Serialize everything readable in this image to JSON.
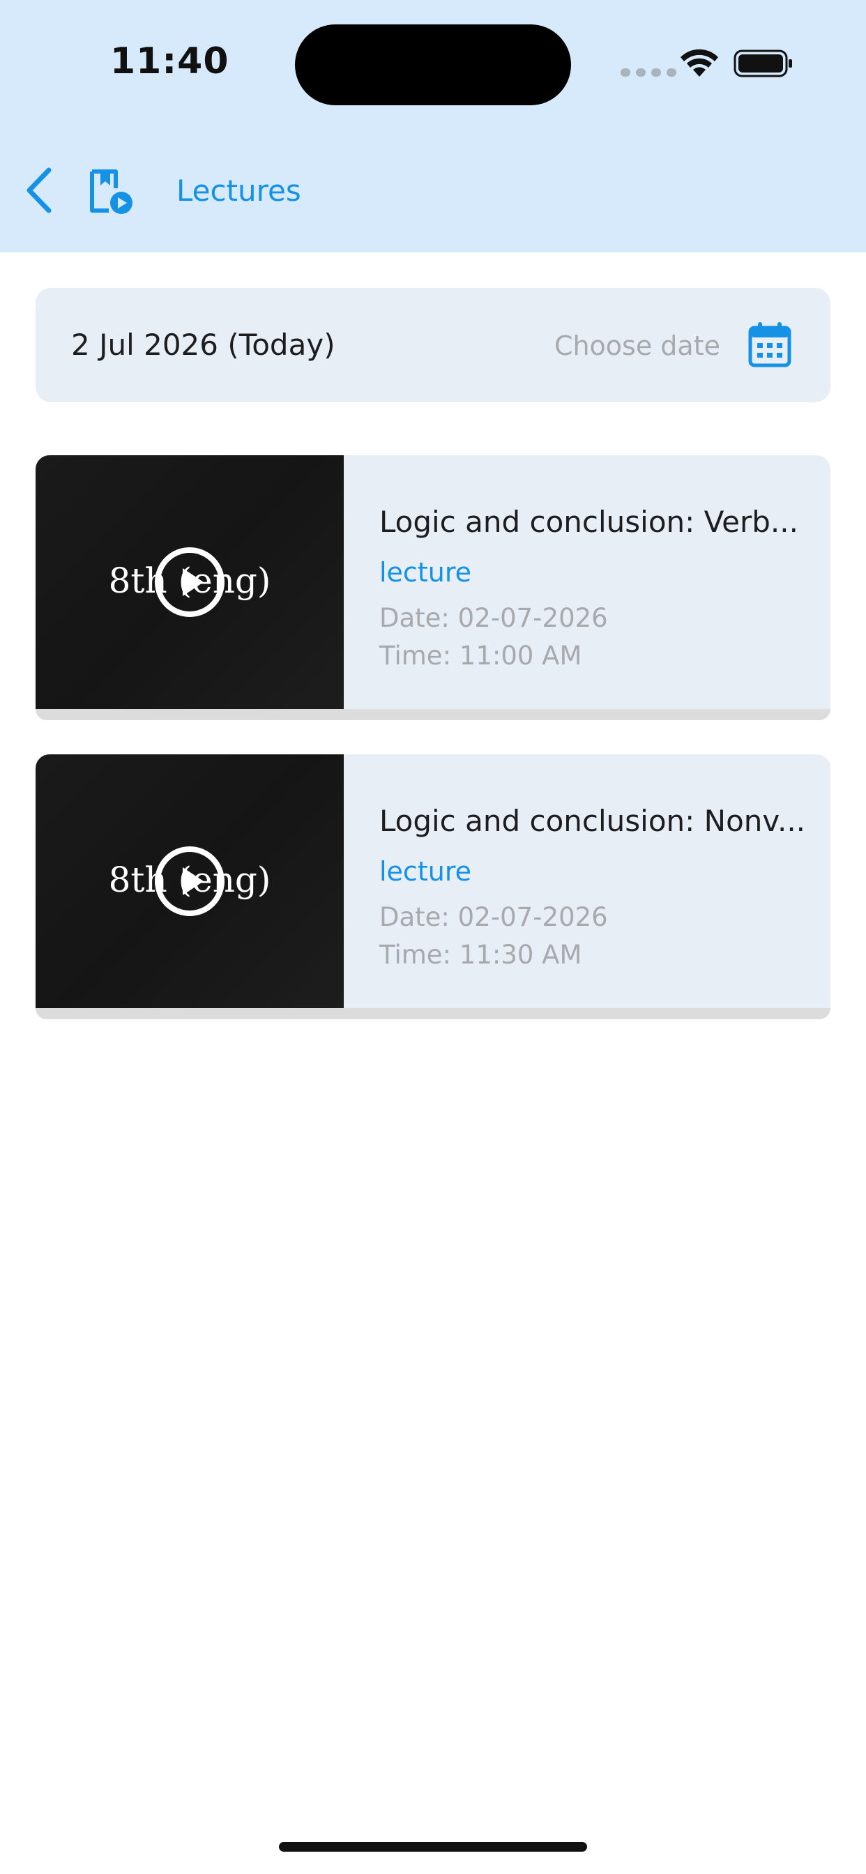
{
  "status_bar": {
    "time": "11:40"
  },
  "header": {
    "title": "Lectures",
    "background": "#d6eafb",
    "accent": "#1592e6",
    "back_icon": "chevron-left-icon",
    "page_icon": "lecture-video-icon"
  },
  "date_picker": {
    "selected_date": "2 Jul 2026 (Today)",
    "choose_label": "Choose date",
    "icon": "calendar-icon"
  },
  "lectures": [
    {
      "thumbnail_text": "8th (eng)",
      "title": "Logic and conclusion: Verb...",
      "type": "lecture",
      "date": "Date: 02-07-2026",
      "time": "Time: 11:00 AM"
    },
    {
      "thumbnail_text": "8th (eng)",
      "title": "Logic and conclusion: Nonv...",
      "type": "lecture",
      "date": "Date: 02-07-2026",
      "time": "Time: 11:30 AM"
    }
  ]
}
